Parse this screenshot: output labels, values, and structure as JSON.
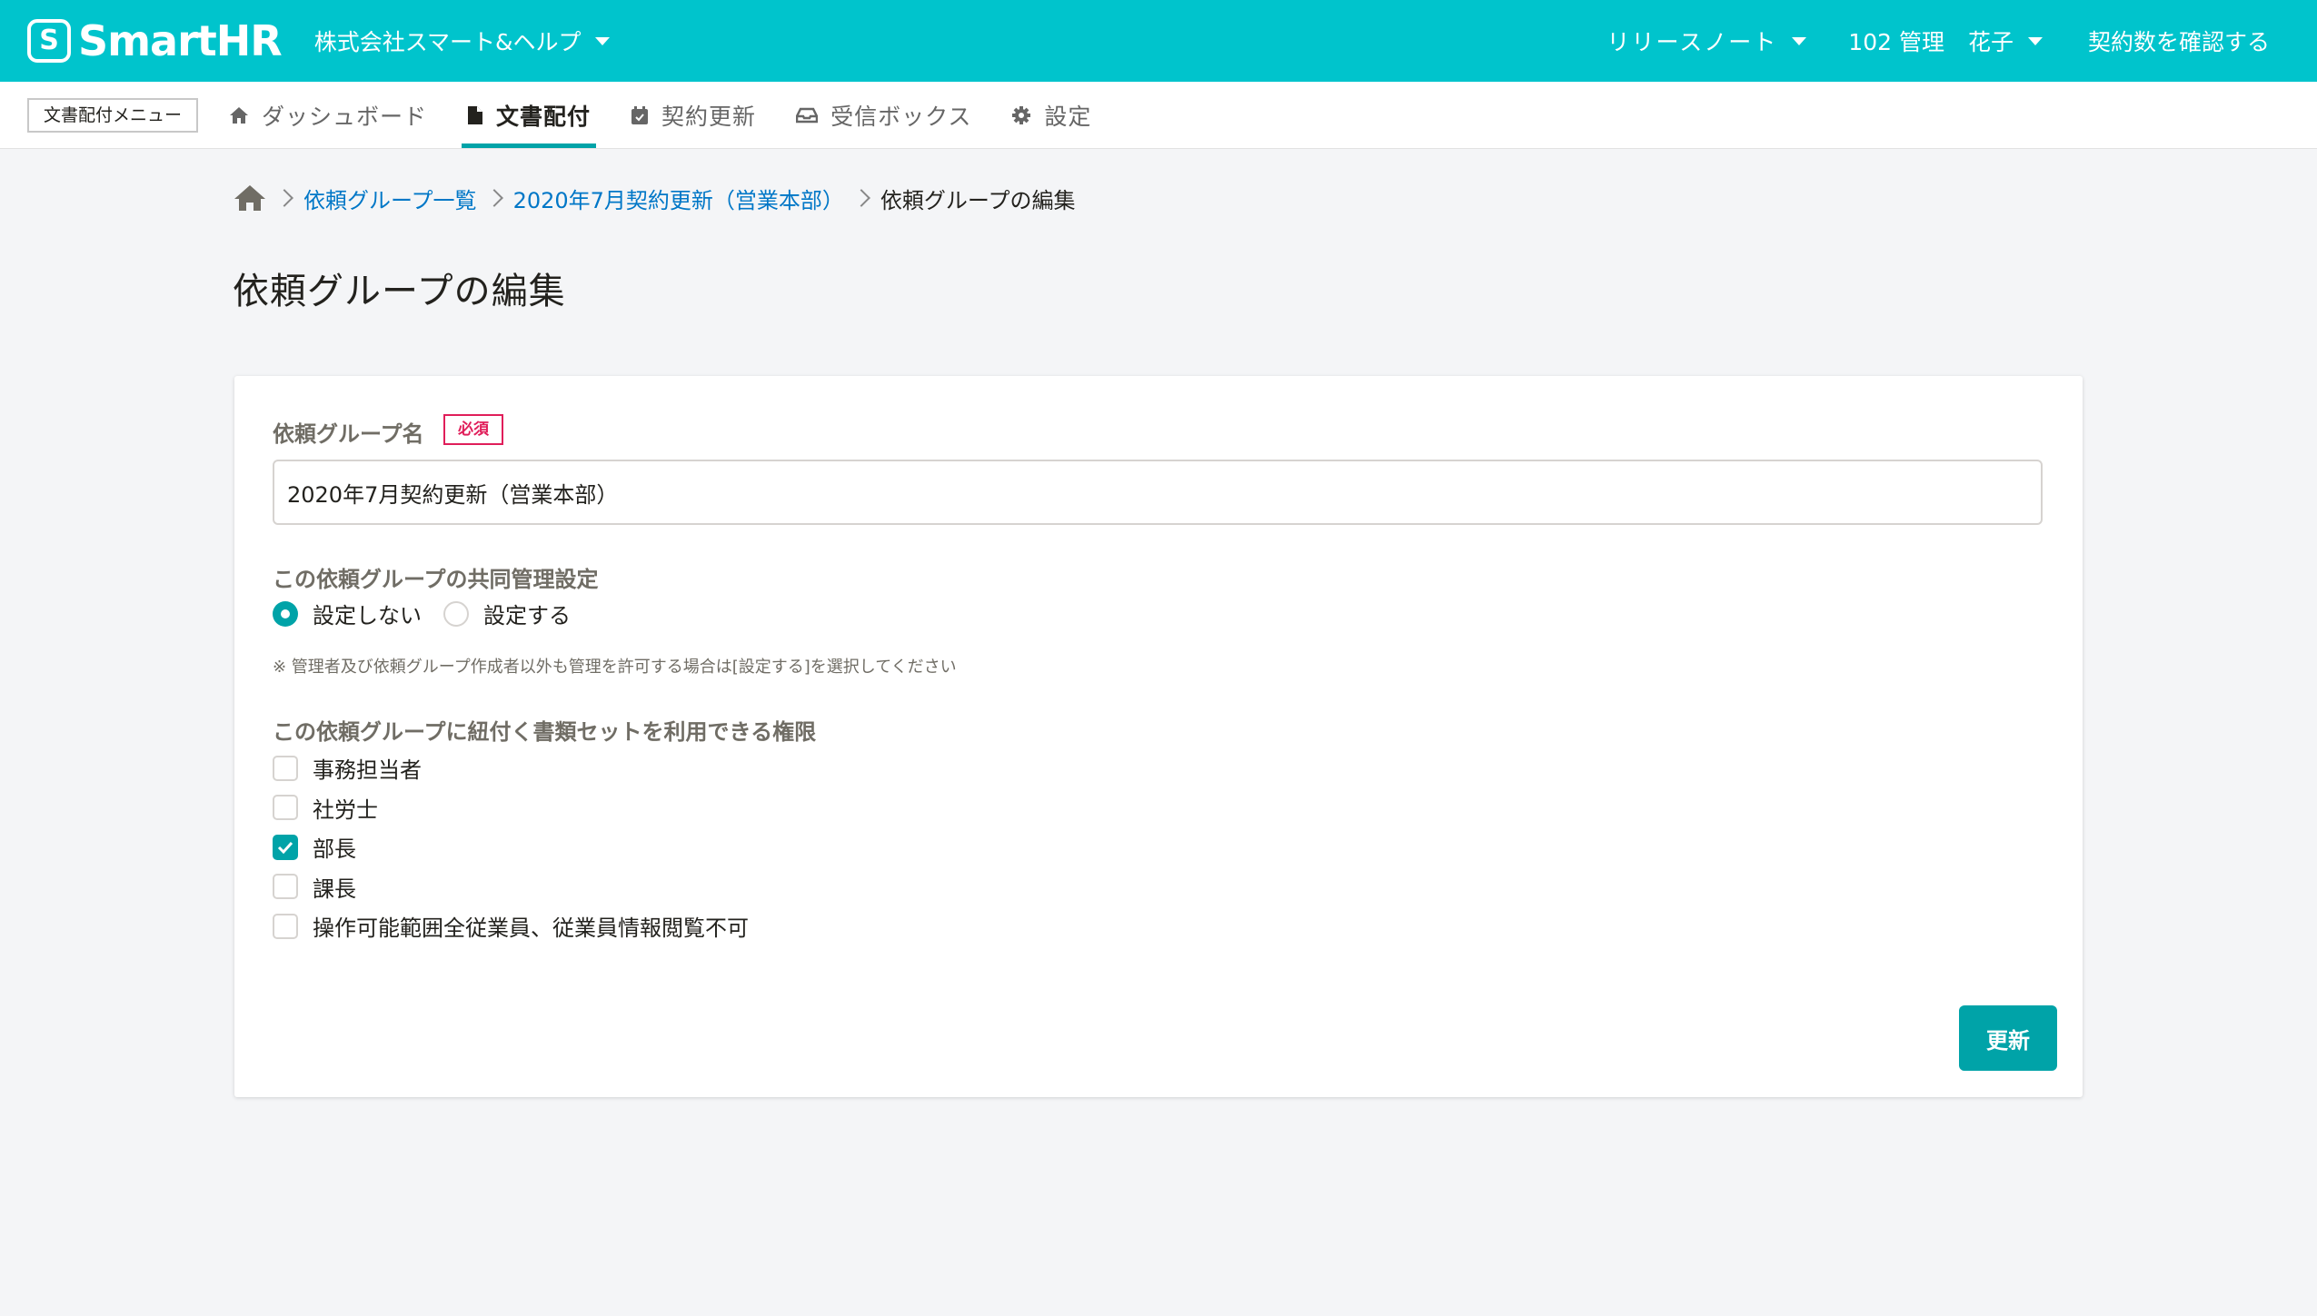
{
  "header": {
    "logo_mark": "S",
    "logo_text": "SmartHR",
    "company": "株式会社スマート&ヘルプ",
    "release_notes": "リリースノート",
    "user_id": "102 管理",
    "user_name": "花子",
    "check_contracts": "契約数を確認する"
  },
  "subnav": {
    "menu_label": "文書配付メニュー",
    "tabs": [
      {
        "label": "ダッシュボード",
        "icon": "home-icon"
      },
      {
        "label": "文書配付",
        "icon": "document-icon",
        "active": true
      },
      {
        "label": "契約更新",
        "icon": "calendar-icon"
      },
      {
        "label": "受信ボックス",
        "icon": "inbox-icon"
      },
      {
        "label": "設定",
        "icon": "gear-icon"
      }
    ]
  },
  "breadcrumb": {
    "items": [
      "依頼グループ一覧",
      "2020年7月契約更新（営業本部）"
    ],
    "current": "依頼グループの編集"
  },
  "page": {
    "title": "依頼グループの編集"
  },
  "form": {
    "group_name_label": "依頼グループ名",
    "required_badge": "必須",
    "group_name_value": "2020年7月契約更新（営業本部）",
    "co_manage_label": "この依頼グループの共同管理設定",
    "co_manage_options": [
      {
        "label": "設定しない",
        "checked": true
      },
      {
        "label": "設定する",
        "checked": false
      }
    ],
    "co_manage_note": "※ 管理者及び依頼グループ作成者以外も管理を許可する場合は[設定する]を選択してください",
    "permission_label": "この依頼グループに紐付く書類セットを利用できる権限",
    "permissions": [
      {
        "label": "事務担当者",
        "checked": false
      },
      {
        "label": "社労士",
        "checked": false
      },
      {
        "label": "部長",
        "checked": true
      },
      {
        "label": "課長",
        "checked": false
      },
      {
        "label": "操作可能範囲全従業員、従業員情報閲覧不可",
        "checked": false
      }
    ],
    "submit_label": "更新"
  },
  "colors": {
    "brand": "#00c4cc",
    "accent": "#00a3a8",
    "link": "#0077c7",
    "danger": "#e01e5a"
  }
}
